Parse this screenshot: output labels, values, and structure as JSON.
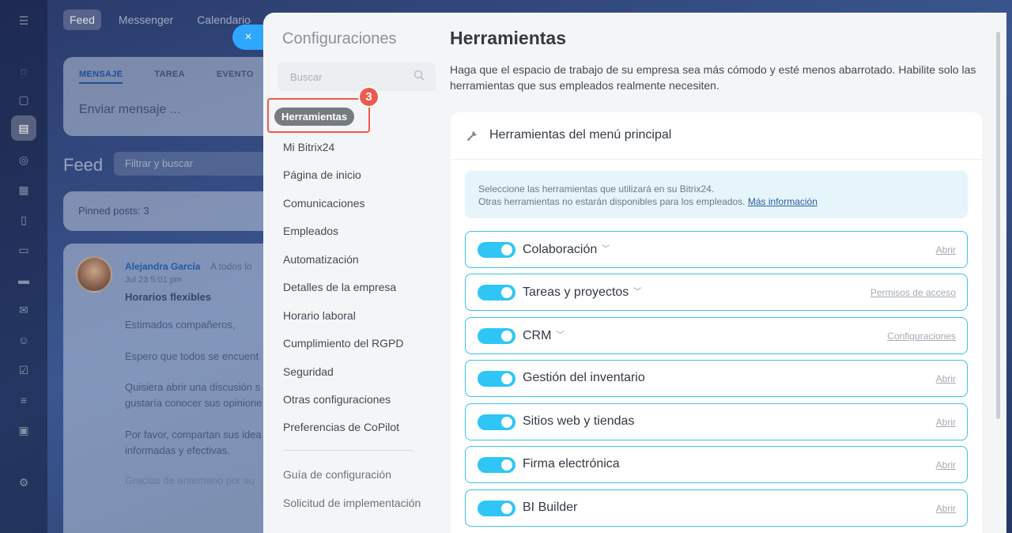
{
  "background_app": {
    "topnav": [
      "Feed",
      "Messenger",
      "Calendario"
    ],
    "composer": {
      "tabs": [
        "MENSAJE",
        "TAREA",
        "EVENTO"
      ],
      "placeholder": "Enviar mensaje ..."
    },
    "feed_title": "Feed",
    "feed_filter_placeholder": "Filtrar y buscar",
    "pinned": "Pinned posts: 3",
    "post": {
      "author": "Alejandra García",
      "to": "A todos lo",
      "date": "Jul 23 5:01 pm",
      "subject": "Horarios flexibles",
      "lines": [
        "Estimados compañeros,",
        "Espero que todos se encuent",
        "Quisiera abrir una discusión s",
        "gustaría conocer sus opinione",
        "Por favor, compartan sus idea",
        "informadas y efectivas.",
        "Gracias de antemano por su"
      ]
    },
    "close_symbol": "×"
  },
  "sidebar": {
    "title": "Configuraciones",
    "search_placeholder": "Buscar",
    "step_number": "3",
    "items": [
      "Herramientas",
      "Mi Bitrix24",
      "Página de inicio",
      "Comunicaciones",
      "Empleados",
      "Automatización",
      "Detalles de la empresa",
      "Horario laboral",
      "Cumplimiento del RGPD",
      "Seguridad",
      "Otras configuraciones",
      "Preferencias de CoPilot"
    ],
    "links": [
      "Guía de configuración",
      "Solicitud de implementación"
    ]
  },
  "main": {
    "title": "Herramientas",
    "description": "Haga que el espacio de trabajo de su empresa sea más cómodo y esté menos abarrotado. Habilite solo las herramientas que sus empleados realmente necesiten.",
    "card_title": "Herramientas del menú principal",
    "info_line1": "Seleccione las herramientas que utilizará en su Bitrix24.",
    "info_line2": "Otras herramientas no estarán disponibles para los empleados.",
    "info_link": "Más información",
    "tools": [
      {
        "label": "Colaboración",
        "link": "Abrir",
        "enabled": true
      },
      {
        "label": "Tareas y proyectos",
        "link": "Permisos de acceso",
        "enabled": true
      },
      {
        "label": "CRM",
        "link": "Configuraciones",
        "enabled": true
      },
      {
        "label": "Gestión del inventario",
        "link": "Abrir",
        "enabled": true
      },
      {
        "label": "Sitios web y tiendas",
        "link": "Abrir",
        "enabled": true
      },
      {
        "label": "Firma electrónica",
        "link": "Abrir",
        "enabled": true
      },
      {
        "label": "BI Builder",
        "link": "Abrir",
        "enabled": true
      }
    ]
  },
  "colors": {
    "toggle_on": "#2fc6f6",
    "row_border": "#3fc0ea",
    "callout": "#ee5a4f",
    "active_nav": "#767b82"
  }
}
